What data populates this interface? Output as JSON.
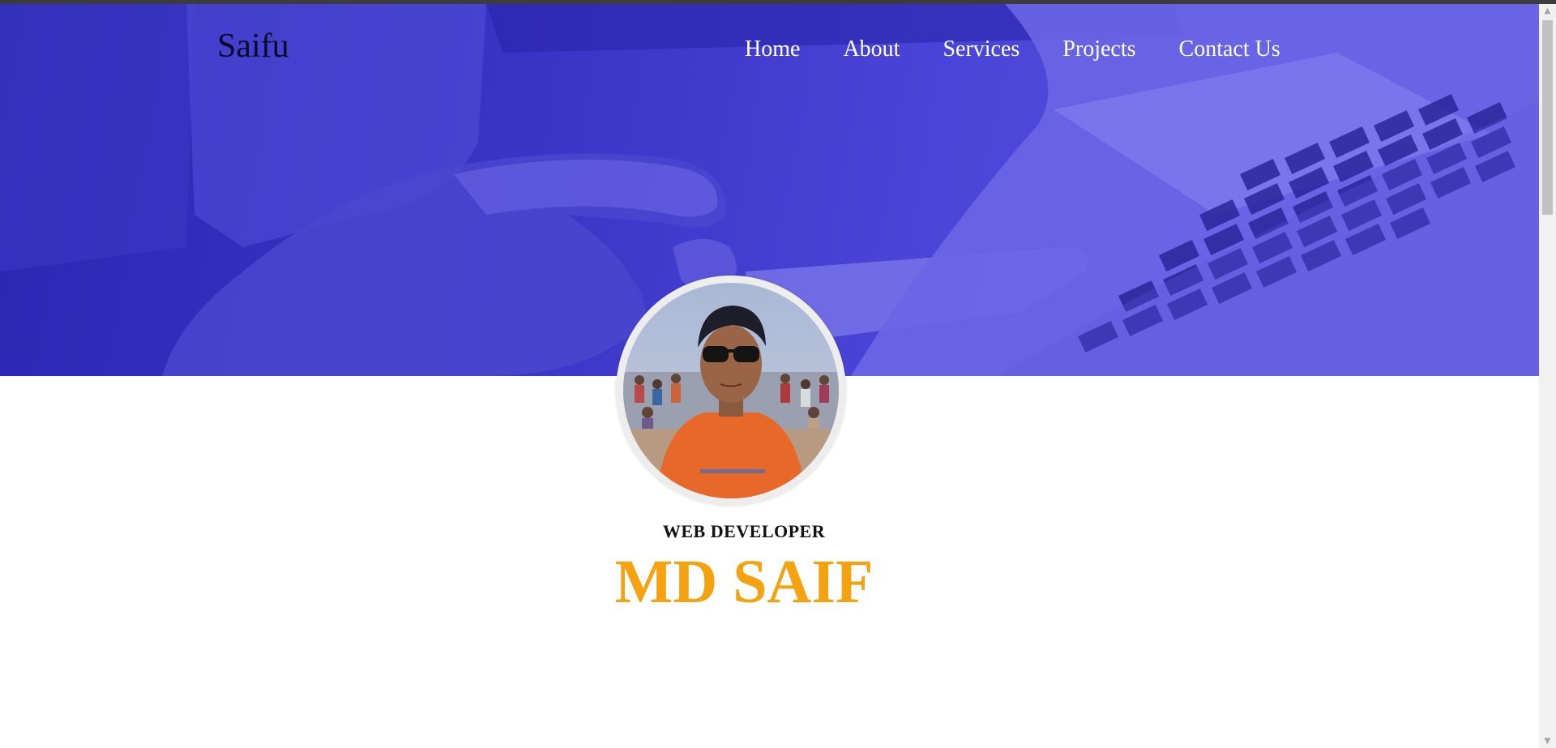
{
  "header": {
    "brand": "Saifu",
    "nav": [
      {
        "label": "Home"
      },
      {
        "label": "About"
      },
      {
        "label": "Services"
      },
      {
        "label": "Projects"
      },
      {
        "label": "Contact Us"
      }
    ]
  },
  "profile": {
    "role": "WEB DEVELOPER",
    "name": "MD SAIF"
  },
  "colors": {
    "hero_overlay": "#3a35c6",
    "name_accent": "#f5a210",
    "nav_text": "#ffffff"
  },
  "icons": {
    "scroll_up": "scroll-up-arrow-icon",
    "scroll_down": "scroll-down-arrow-icon"
  }
}
